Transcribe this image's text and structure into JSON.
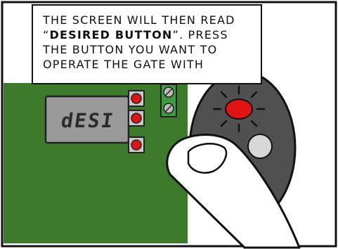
{
  "caption": {
    "line1": "The screen will then read",
    "quote_open": "“",
    "emphasis": "Desired Button",
    "quote_close": "”.",
    "line2_rest": " Press",
    "line3": "the button you want to",
    "line4": "operate the gate with"
  },
  "display": {
    "text": "dESI"
  },
  "colors": {
    "board": "#3e7a2c",
    "lcd": "#9a9a9a",
    "remote": "#505050",
    "led": "#e01414",
    "terminal": "#3f9b3f"
  }
}
